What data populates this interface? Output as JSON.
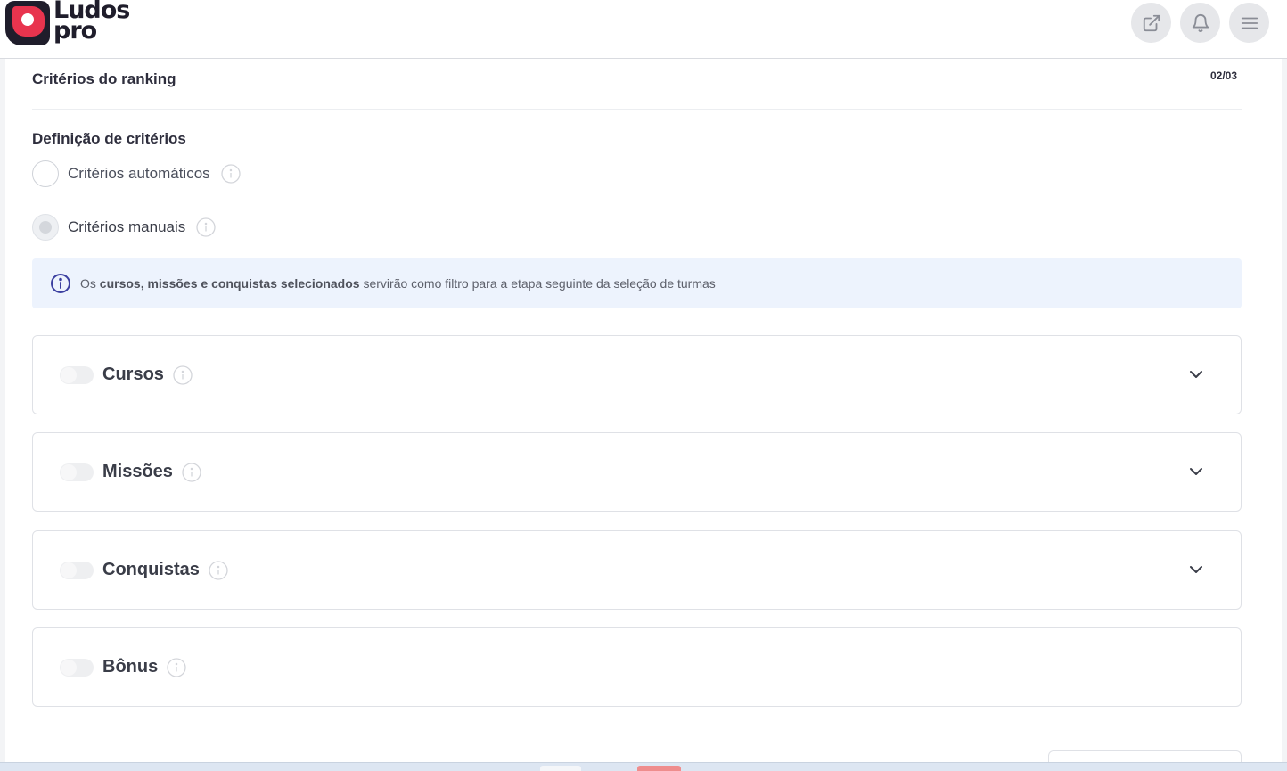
{
  "header": {
    "logo": {
      "line1": "Ludos",
      "line2": "pro"
    },
    "buttons": [
      {
        "icon": "external-link-icon"
      },
      {
        "icon": "bell-icon"
      },
      {
        "icon": "menu-icon"
      }
    ]
  },
  "step": {
    "title": "Critérios do ranking",
    "counter": "02/03"
  },
  "definition": {
    "title": "Definição de critérios",
    "options": [
      {
        "label": "Critérios automáticos",
        "selected": false
      },
      {
        "label": "Critérios manuais",
        "selected": true
      }
    ]
  },
  "notice": {
    "prefix": "Os ",
    "highlight": "cursos, missões e conquistas selecionados",
    "suffix": " servirão como filtro para a etapa seguinte da seleção de turmas"
  },
  "sections": [
    {
      "label": "Cursos",
      "enabled": false,
      "expandable": true
    },
    {
      "label": "Missões",
      "enabled": false,
      "expandable": true
    },
    {
      "label": "Conquistas",
      "enabled": false,
      "expandable": true
    },
    {
      "label": "Bônus",
      "enabled": false,
      "expandable": false
    }
  ],
  "colors": {
    "brand_dark": "#1f1d2b",
    "brand_red": "#e8344e",
    "notice_bg": "#edf3fd",
    "info_blue": "#3b3fa0"
  }
}
